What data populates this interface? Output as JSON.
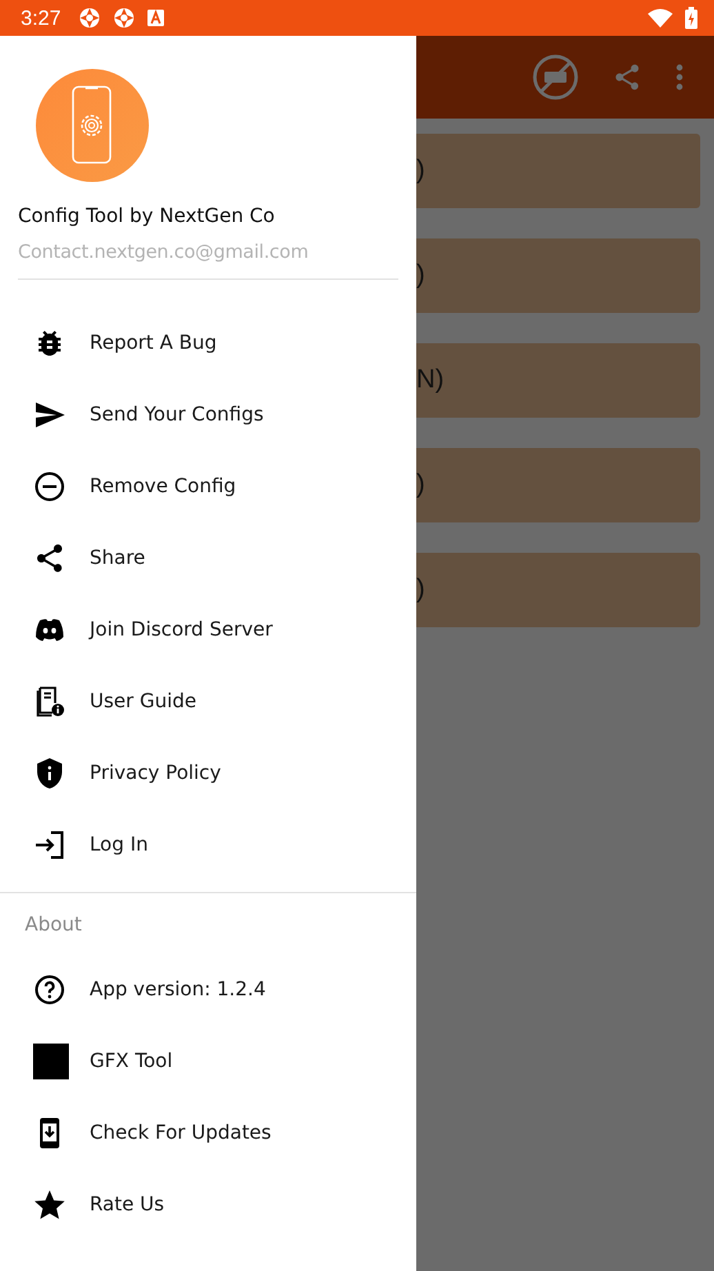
{
  "status_bar": {
    "time": "3:27"
  },
  "drawer": {
    "app_name": "Config Tool by NextGen Co",
    "email": "Contact.nextgen.co@gmail.com",
    "menu": [
      {
        "label": "Report A Bug"
      },
      {
        "label": "Send Your Configs"
      },
      {
        "label": "Remove Config"
      },
      {
        "label": "Share"
      },
      {
        "label": "Join Discord Server"
      },
      {
        "label": "User Guide"
      },
      {
        "label": "Privacy Policy"
      },
      {
        "label": "Log In"
      }
    ],
    "about": {
      "heading": "About",
      "items": [
        {
          "label": "App version: 1.2.4"
        },
        {
          "label": "GFX Tool"
        },
        {
          "label": "Check For Updates"
        },
        {
          "label": "Rate Us"
        }
      ]
    }
  },
  "background_list": [
    {
      "text": ")"
    },
    {
      "text": ")"
    },
    {
      "text": "N)"
    },
    {
      "text": ")"
    },
    {
      "text": ")"
    }
  ]
}
